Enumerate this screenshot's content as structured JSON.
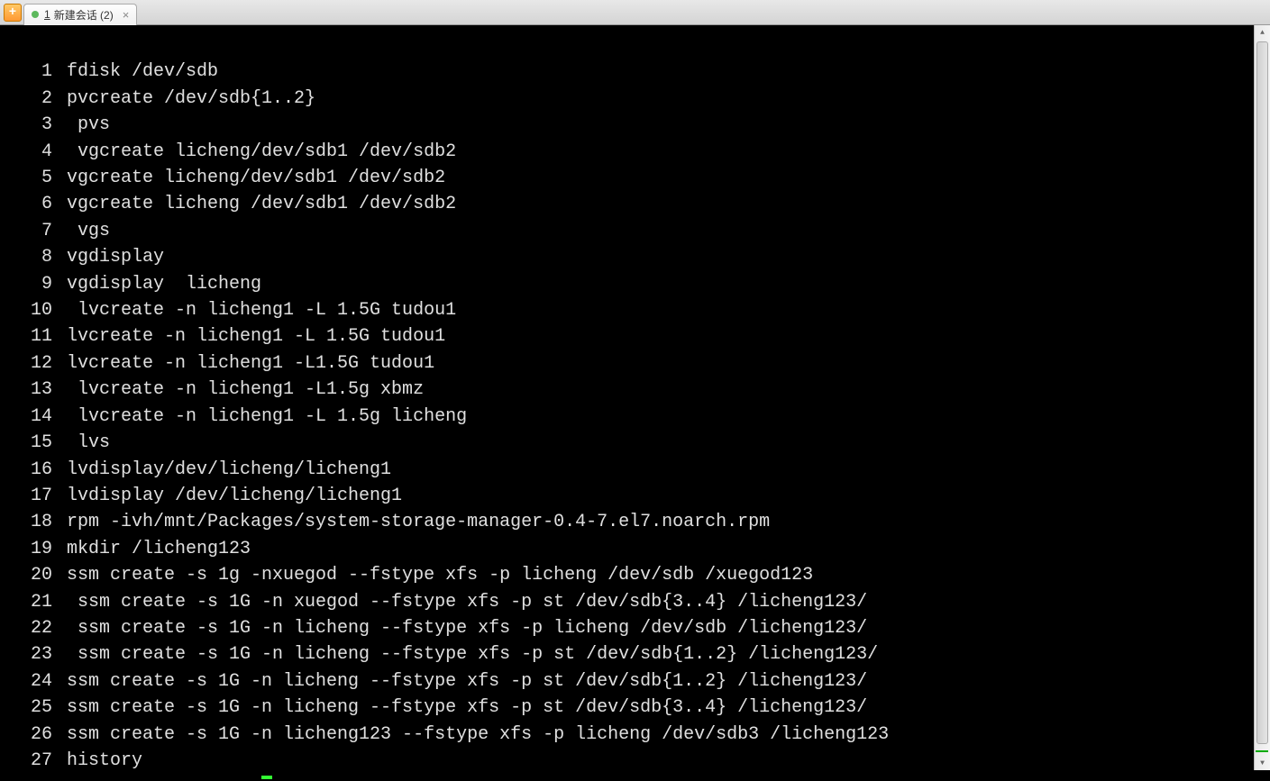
{
  "tab_bar": {
    "new_tab_symbol": "+",
    "active_tab": {
      "number": "1",
      "title": "新建会话 (2)",
      "close_symbol": "×"
    }
  },
  "history": [
    {
      "n": "1",
      "cmd": "fdisk /dev/sdb"
    },
    {
      "n": "2",
      "cmd": "pvcreate /dev/sdb{1..2}"
    },
    {
      "n": "3",
      "cmd": " pvs"
    },
    {
      "n": "4",
      "cmd": " vgcreate licheng/dev/sdb1 /dev/sdb2"
    },
    {
      "n": "5",
      "cmd": "vgcreate licheng/dev/sdb1 /dev/sdb2"
    },
    {
      "n": "6",
      "cmd": "vgcreate licheng /dev/sdb1 /dev/sdb2"
    },
    {
      "n": "7",
      "cmd": " vgs"
    },
    {
      "n": "8",
      "cmd": "vgdisplay"
    },
    {
      "n": "9",
      "cmd": "vgdisplay  licheng"
    },
    {
      "n": "10",
      "cmd": " lvcreate -n licheng1 -L 1.5G tudou1"
    },
    {
      "n": "11",
      "cmd": "lvcreate -n licheng1 -L 1.5G tudou1"
    },
    {
      "n": "12",
      "cmd": "lvcreate -n licheng1 -L1.5G tudou1"
    },
    {
      "n": "13",
      "cmd": " lvcreate -n licheng1 -L1.5g xbmz"
    },
    {
      "n": "14",
      "cmd": " lvcreate -n licheng1 -L 1.5g licheng"
    },
    {
      "n": "15",
      "cmd": " lvs"
    },
    {
      "n": "16",
      "cmd": "lvdisplay/dev/licheng/licheng1"
    },
    {
      "n": "17",
      "cmd": "lvdisplay /dev/licheng/licheng1"
    },
    {
      "n": "18",
      "cmd": "rpm -ivh/mnt/Packages/system-storage-manager-0.4-7.el7.noarch.rpm"
    },
    {
      "n": "19",
      "cmd": "mkdir /licheng123"
    },
    {
      "n": "20",
      "cmd": "ssm create -s 1g -nxuegod --fstype xfs -p licheng /dev/sdb /xuegod123"
    },
    {
      "n": "21",
      "cmd": " ssm create -s 1G -n xuegod --fstype xfs -p st /dev/sdb{3..4} /licheng123/"
    },
    {
      "n": "22",
      "cmd": " ssm create -s 1G -n licheng --fstype xfs -p licheng /dev/sdb /licheng123/"
    },
    {
      "n": "23",
      "cmd": " ssm create -s 1G -n licheng --fstype xfs -p st /dev/sdb{1..2} /licheng123/"
    },
    {
      "n": "24",
      "cmd": "ssm create -s 1G -n licheng --fstype xfs -p st /dev/sdb{1..2} /licheng123/"
    },
    {
      "n": "25",
      "cmd": "ssm create -s 1G -n licheng --fstype xfs -p st /dev/sdb{3..4} /licheng123/"
    },
    {
      "n": "26",
      "cmd": "ssm create -s 1G -n licheng123 --fstype xfs -p licheng /dev/sdb3 /licheng123"
    },
    {
      "n": "27",
      "cmd": "history"
    }
  ],
  "scroll": {
    "up_arrow": "▲",
    "down_arrow": "▼"
  }
}
